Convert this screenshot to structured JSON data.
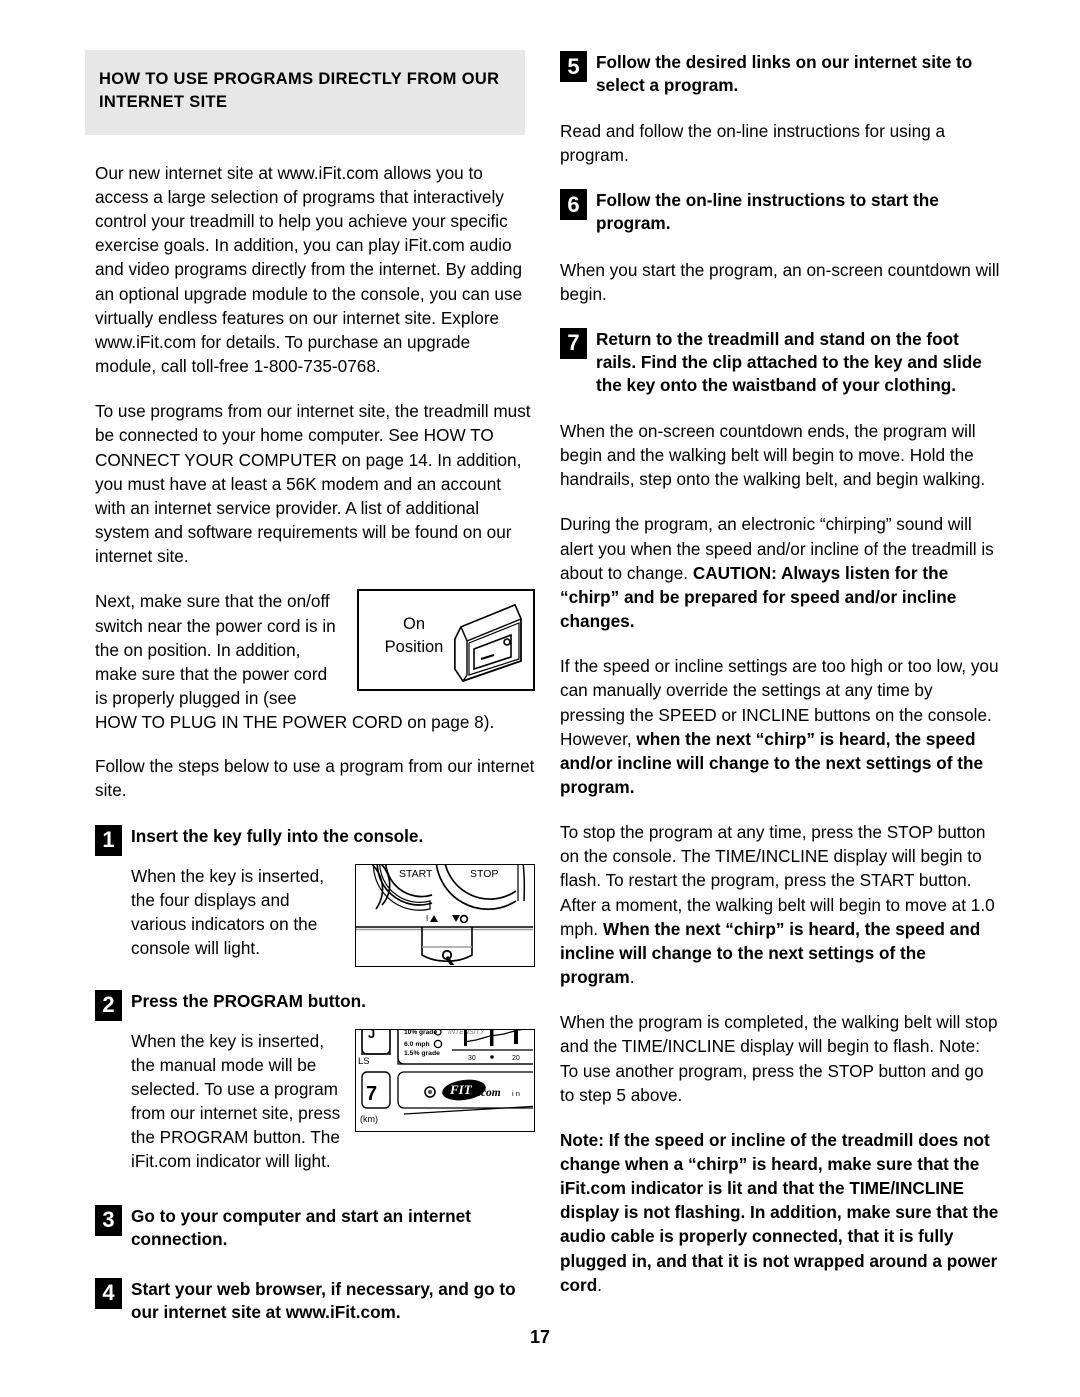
{
  "page": {
    "number": "17"
  },
  "left_column": {
    "section_heading": "HOW TO USE PROGRAMS DIRECTLY FROM OUR INTERNET SITE",
    "paragraph_1": "Our new internet site at www.iFit.com allows you to access a large selection of programs that interactively control your treadmill to help you achieve your specific exercise goals. In addition, you can play iFit.com audio and video programs directly from the internet. By adding an optional upgrade module to the console, you can use virtually endless features on our internet site. Explore www.iFit.com for details. To purchase an upgrade module, call toll-free 1-800-735-0768.",
    "paragraph_2": "To use programs from our internet site, the treadmill must be connected to your home computer. See HOW TO CONNECT YOUR COMPUTER on page 14. In addition, you must have at least a 56K modem and an account with an internet service provider. A list of additional system and software requirements will be found on our internet site.",
    "paragraph_3_wrap": "Next, make sure that the on/off switch near the power cord is in the on position. In addition, make sure that the power cord is properly plugged in (see",
    "paragraph_3_tail": "HOW TO PLUG IN THE POWER CORD on page 8).",
    "paragraph_4": "Follow the steps below to use a program from our internet site.",
    "switch_figure": {
      "label_line_1": "On",
      "label_line_2": "Position",
      "name": "on-position-switch-illustration"
    },
    "steps": [
      {
        "number": "1",
        "heading": "Insert the key fully into the console.",
        "body": "When the key is inserted, the four displays and various indicators on the console will light.",
        "figure": {
          "name": "console-start-stop-illustration",
          "start_label": "START",
          "stop_label": "STOP"
        }
      },
      {
        "number": "2",
        "heading": "Press the PROGRAM button.",
        "body": "When the key is inserted, the manual mode will be selected. To use a program from our internet site, press the PROGRAM button. The iFit.com indicator will light.",
        "figure": {
          "name": "console-ifit-indicator-illustration",
          "grade_top": "10% grade",
          "speed": "6.0 mph",
          "grade_bottom": "1.5% grade",
          "intensity_label": "INTENSITY",
          "scale_left": "30",
          "scale_right": "20",
          "brand": "iFIT.com",
          "units_label": "(km)",
          "left_digit": "7",
          "ls_label": "LS",
          "in_label": "i  n"
        }
      },
      {
        "number": "3",
        "heading": "Go to your computer and start an internet connection.",
        "body": ""
      },
      {
        "number": "4",
        "heading": "Start your web browser, if necessary, and go to our internet site at www.iFit.com.",
        "body": ""
      }
    ]
  },
  "right_column": {
    "steps": [
      {
        "number": "5",
        "heading": "Follow the desired links on our internet site to select a program.",
        "body": "Read and follow the on-line instructions for using a program."
      },
      {
        "number": "6",
        "heading": "Follow the on-line instructions to start the program.",
        "body": "When you start the program, an on-screen countdown will begin."
      },
      {
        "number": "7",
        "heading": "Return to the treadmill and stand on the foot rails. Find the clip attached to the key and slide the key onto the waistband of your clothing.",
        "body": "When the on-screen countdown ends, the program will begin and the walking belt will begin to move. Hold the handrails, step onto the walking belt, and begin walking."
      }
    ],
    "paragraph_chirp_plain": "During the program, an electronic “chirping” sound will alert you when the speed and/or incline of the treadmill is about to change. ",
    "paragraph_chirp_bold": "CAUTION: Always listen for the “chirp” and be prepared for speed and/or incline changes.",
    "paragraph_override_plain": "If the speed or incline settings are too high or too low, you can manually override the settings at any time by pressing the SPEED or INCLINE buttons on the console. However, ",
    "paragraph_override_bold": "when the next “chirp” is heard, the speed and/or incline will change to the next settings of the program.",
    "paragraph_stop_plain": "To stop the program at any time, press the STOP button on the console. The TIME/INCLINE display will begin to flash. To restart the program, press the START button. After a moment, the walking belt will begin to move at 1.0 mph. ",
    "paragraph_stop_bold": "When the next “chirp” is heard, the speed and incline will change to the next settings of the program",
    "paragraph_stop_tail": ".",
    "paragraph_complete": "When the program is completed, the walking belt will stop and the TIME/INCLINE display will begin to flash. Note: To use another program, press the STOP button and go to step 5 above.",
    "paragraph_note_bold": "Note: If the speed or incline of the treadmill does not change when a “chirp” is heard, make sure that the iFit.com indicator is lit and that the TIME/INCLINE display is not flashing. In addition, make sure that the audio cable is properly connected, that it is fully plugged in, and that it is not wrapped around a power cord",
    "paragraph_note_tail": "."
  },
  "colors": {
    "band_background": "#e7e7e7",
    "text": "#000000",
    "step_badge": "#000000"
  }
}
